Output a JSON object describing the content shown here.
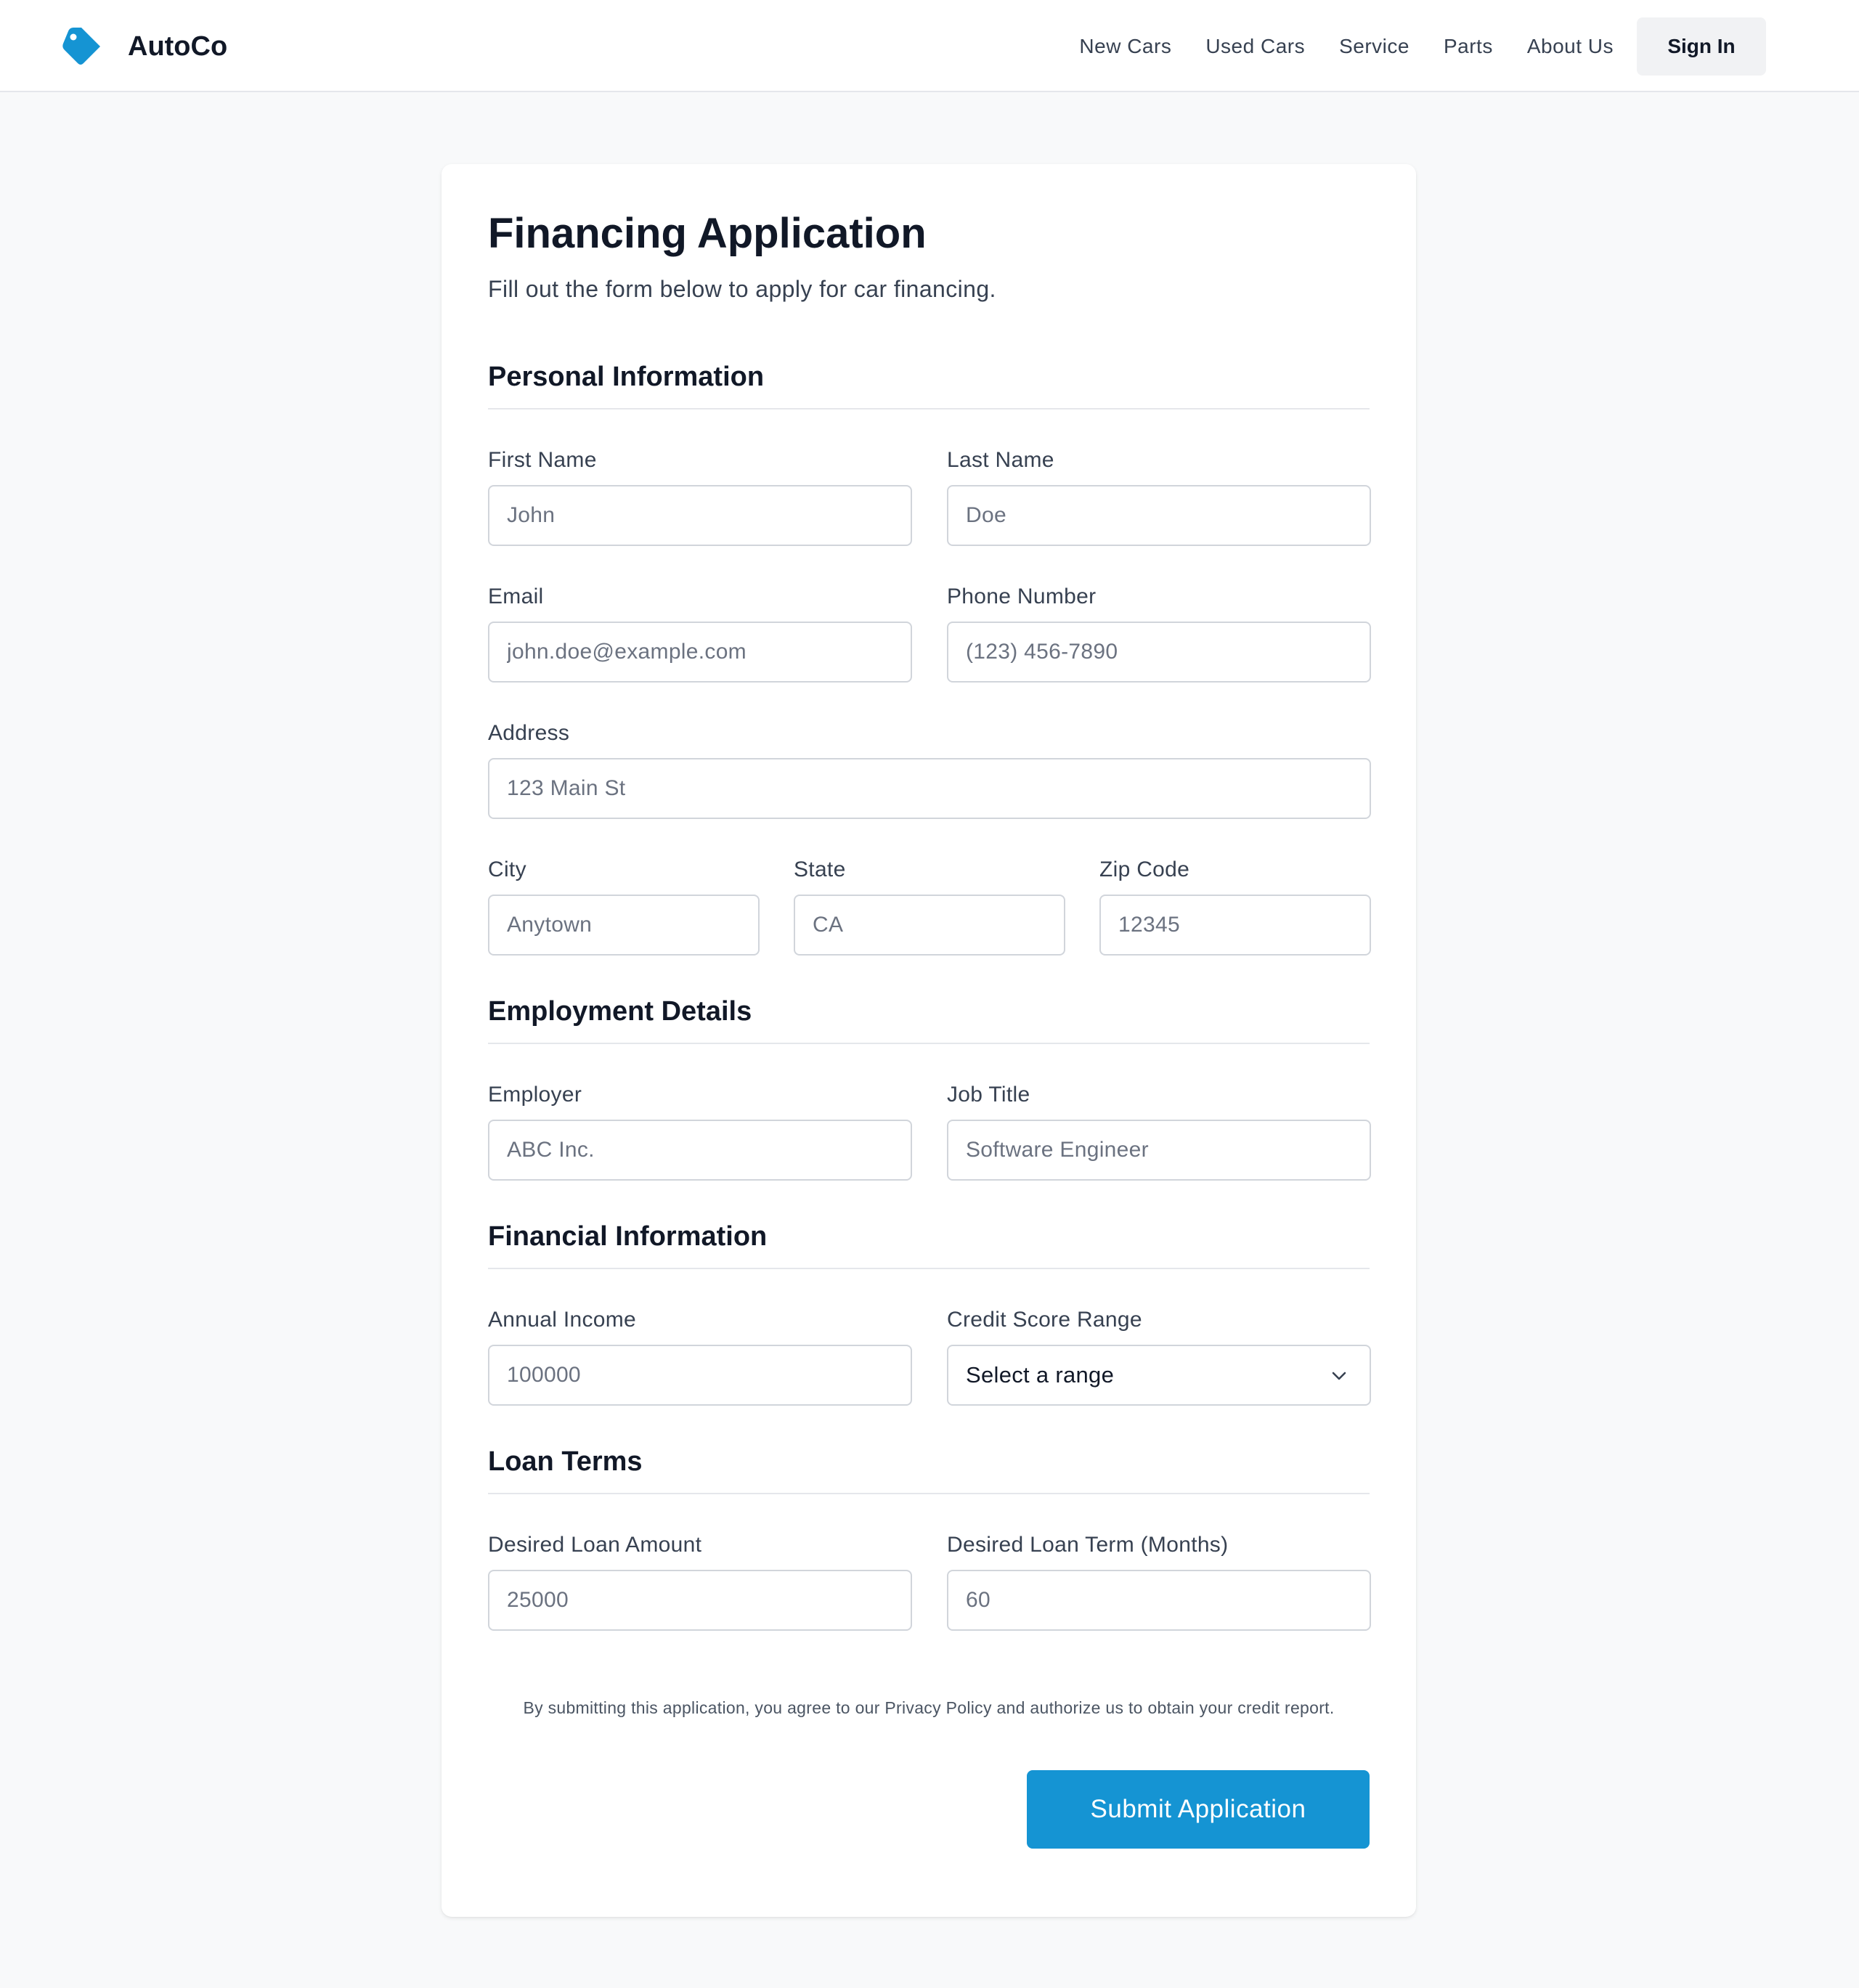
{
  "nav": {
    "brand": "AutoCo",
    "logo_icon": "tag-icon",
    "links": [
      "New Cars",
      "Used Cars",
      "Service",
      "Parts",
      "About Us"
    ],
    "sign_in": "Sign In"
  },
  "page": {
    "title": "Financing Application",
    "subtitle": "Fill out the form below to apply for car financing."
  },
  "sections": {
    "personal": {
      "title": "Personal Information",
      "first_name": {
        "label": "First Name",
        "placeholder": "John"
      },
      "last_name": {
        "label": "Last Name",
        "placeholder": "Doe"
      },
      "email": {
        "label": "Email",
        "placeholder": "john.doe@example.com"
      },
      "phone": {
        "label": "Phone Number",
        "placeholder": "(123) 456-7890"
      },
      "address": {
        "label": "Address",
        "placeholder": "123 Main St"
      },
      "city": {
        "label": "City",
        "placeholder": "Anytown"
      },
      "state": {
        "label": "State",
        "placeholder": "CA"
      },
      "zip": {
        "label": "Zip Code",
        "placeholder": "12345"
      }
    },
    "employment": {
      "title": "Employment Details",
      "employer": {
        "label": "Employer",
        "placeholder": "ABC Inc."
      },
      "job_title": {
        "label": "Job Title",
        "placeholder": "Software Engineer"
      }
    },
    "financial": {
      "title": "Financial Information",
      "income": {
        "label": "Annual Income",
        "placeholder": "100000"
      },
      "credit": {
        "label": "Credit Score Range",
        "selected": "Select a range"
      }
    },
    "loan": {
      "title": "Loan Terms",
      "amount": {
        "label": "Desired Loan Amount",
        "placeholder": "25000"
      },
      "term": {
        "label": "Desired Loan Term (Months)",
        "placeholder": "60"
      }
    }
  },
  "consent": "By submitting this application, you agree to our Privacy Policy and authorize us to obtain your credit report.",
  "submit": "Submit Application",
  "colors": {
    "accent": "#1594d3",
    "page_bg": "#f8f9fa",
    "text_dark": "#111827"
  }
}
